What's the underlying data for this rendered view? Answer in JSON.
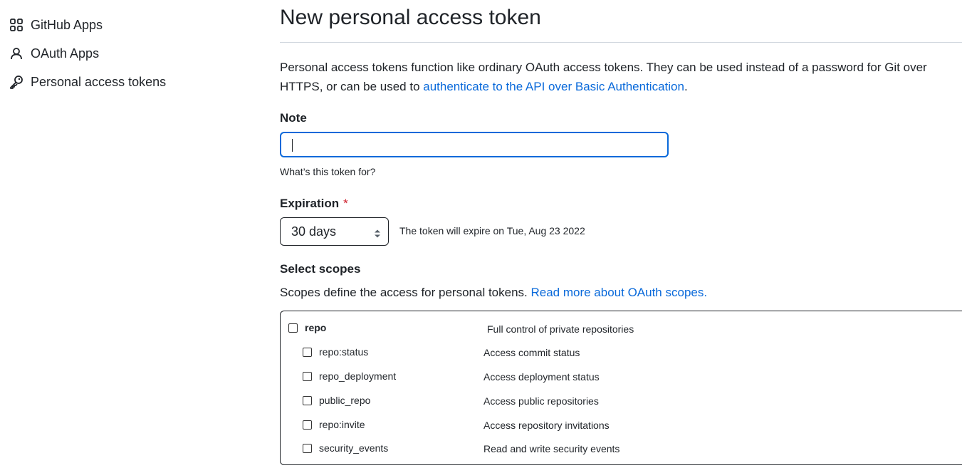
{
  "sidebar": {
    "items": [
      {
        "label": "GitHub Apps",
        "icon": "apps-grid-icon"
      },
      {
        "label": "OAuth Apps",
        "icon": "person-icon"
      },
      {
        "label": "Personal access tokens",
        "icon": "key-icon"
      }
    ]
  },
  "page": {
    "title": "New personal access token",
    "intro_text": "Personal access tokens function like ordinary OAuth access tokens. They can be used instead of a password for Git over HTTPS, or can be used to ",
    "intro_link": "authenticate to the API over Basic Authentication",
    "intro_end": "."
  },
  "note": {
    "label": "Note",
    "value": "",
    "hint": "What’s this token for?"
  },
  "expiration": {
    "label": "Expiration",
    "required_mark": "*",
    "selected": "30 days",
    "expire_text": "The token will expire on Tue, Aug 23 2022"
  },
  "scopes": {
    "label": "Select scopes",
    "description": "Scopes define the access for personal tokens. ",
    "link": "Read more about OAuth scopes.",
    "rows": [
      {
        "name": "repo",
        "desc": "Full control of private repositories",
        "checked": false,
        "level": 0
      },
      {
        "name": "repo:status",
        "desc": "Access commit status",
        "checked": false,
        "level": 1
      },
      {
        "name": "repo_deployment",
        "desc": "Access deployment status",
        "checked": false,
        "level": 1
      },
      {
        "name": "public_repo",
        "desc": "Access public repositories",
        "checked": false,
        "level": 1
      },
      {
        "name": "repo:invite",
        "desc": "Access repository invitations",
        "checked": false,
        "level": 1
      },
      {
        "name": "security_events",
        "desc": "Read and write security events",
        "checked": false,
        "level": 1
      }
    ]
  },
  "colors": {
    "link": "#0969da",
    "focus": "#0969da",
    "required": "#cf222e",
    "text": "#1f2328"
  }
}
